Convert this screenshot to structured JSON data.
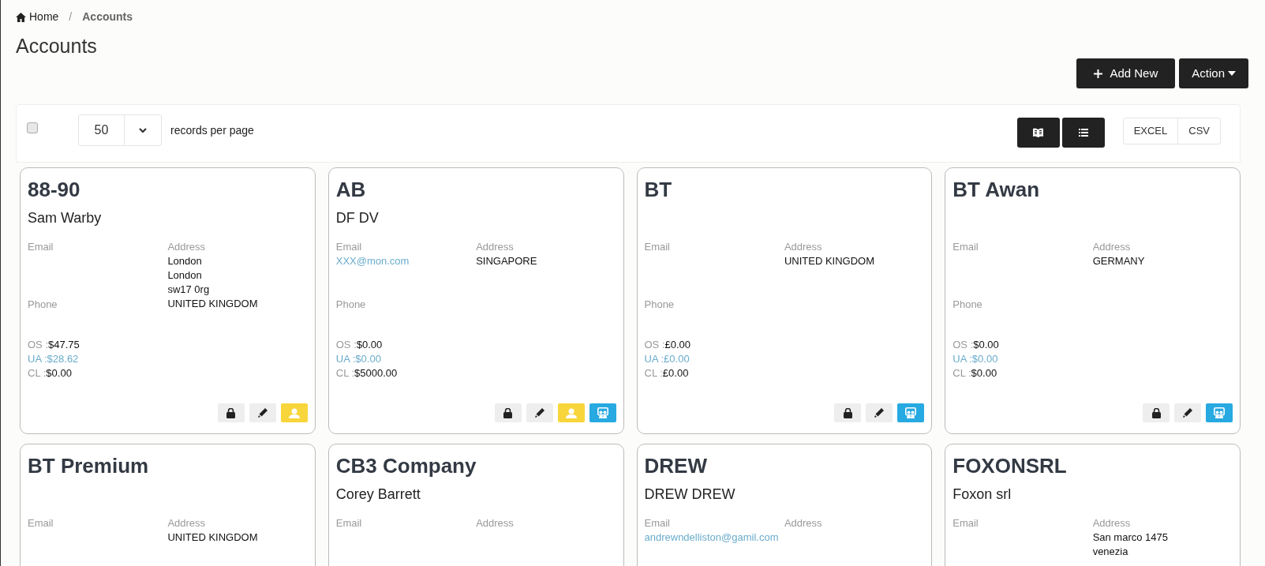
{
  "breadcrumb_separator": "/",
  "breadcrumb": [
    {
      "label": "Home",
      "kind": "link"
    },
    {
      "label": "Accounts",
      "kind": "current"
    }
  ],
  "title": "Accounts",
  "header_buttons": [
    {
      "label": "Add New",
      "kind": "add"
    },
    {
      "label": "Action",
      "kind": "dropdown"
    }
  ],
  "toolbar": {
    "select_all": {
      "checked": false
    },
    "page_size": "50",
    "page_size_label": "records per page",
    "view_buttons": [
      {
        "kind": "grid"
      },
      {
        "kind": "list"
      }
    ],
    "export_buttons": [
      "EXCEL",
      "CSV"
    ]
  },
  "cards": [
    {
      "code": "88-90",
      "contact": "Sam Warby",
      "email_label": "Email",
      "address_label": "Address",
      "address": [
        "London",
        "London",
        "sw17 0rg",
        "UNITED KINGDOM"
      ],
      "phone_label": "Phone",
      "amounts": [
        {
          "label": "OS :",
          "value": "$47.75",
          "kind": "plain"
        },
        {
          "label": "UA :",
          "value": "$28.62",
          "kind": "link"
        },
        {
          "label": "CL :",
          "value": "$0.00",
          "kind": "plain"
        }
      ],
      "actions": [
        {
          "kind": "lock"
        },
        {
          "kind": "edit"
        },
        {
          "kind": "user"
        }
      ]
    },
    {
      "code": "AB",
      "contact": "DF DV",
      "email_label": "Email",
      "email": "XXX@mon.com",
      "address_label": "Address",
      "address": [
        "SINGAPORE"
      ],
      "phone_label": "Phone",
      "amounts": [
        {
          "label": "OS :",
          "value": "$0.00",
          "kind": "plain"
        },
        {
          "label": "UA :",
          "value": "$0.00",
          "kind": "link"
        },
        {
          "label": "CL :",
          "value": "$5000.00",
          "kind": "plain"
        }
      ],
      "actions": [
        {
          "kind": "lock"
        },
        {
          "kind": "edit"
        },
        {
          "kind": "user"
        },
        {
          "kind": "board"
        }
      ]
    },
    {
      "code": "BT",
      "email_label": "Email",
      "address_label": "Address",
      "address": [
        "UNITED KINGDOM"
      ],
      "phone_label": "Phone",
      "amounts": [
        {
          "label": "OS :",
          "value": "£0.00",
          "kind": "plain"
        },
        {
          "label": "UA :",
          "value": "£0.00",
          "kind": "link"
        },
        {
          "label": "CL :",
          "value": "£0.00",
          "kind": "plain"
        }
      ],
      "actions": [
        {
          "kind": "lock"
        },
        {
          "kind": "edit"
        },
        {
          "kind": "board"
        }
      ]
    },
    {
      "code": "BT Awan",
      "email_label": "Email",
      "address_label": "Address",
      "address": [
        "GERMANY"
      ],
      "phone_label": "Phone",
      "amounts": [
        {
          "label": "OS :",
          "value": "$0.00",
          "kind": "plain"
        },
        {
          "label": "UA :",
          "value": "$0.00",
          "kind": "link"
        },
        {
          "label": "CL :",
          "value": "$0.00",
          "kind": "plain"
        }
      ],
      "actions": [
        {
          "kind": "lock"
        },
        {
          "kind": "edit"
        },
        {
          "kind": "board"
        }
      ]
    },
    {
      "code": "BT Premium",
      "email_label": "Email",
      "address_label": "Address",
      "address": [
        "UNITED KINGDOM"
      ]
    },
    {
      "code": "CB3 Company",
      "contact": "Corey Barrett",
      "email_label": "Email",
      "address_label": "Address"
    },
    {
      "code": "DREW",
      "contact": "DREW DREW",
      "email_label": "Email",
      "email": "andrewndelliston@gamil.com",
      "address_label": "Address"
    },
    {
      "code": "FOXONSRL",
      "contact": "Foxon srl",
      "email_label": "Email",
      "address_label": "Address",
      "address": [
        "San marco 1475",
        "venezia"
      ]
    }
  ]
}
